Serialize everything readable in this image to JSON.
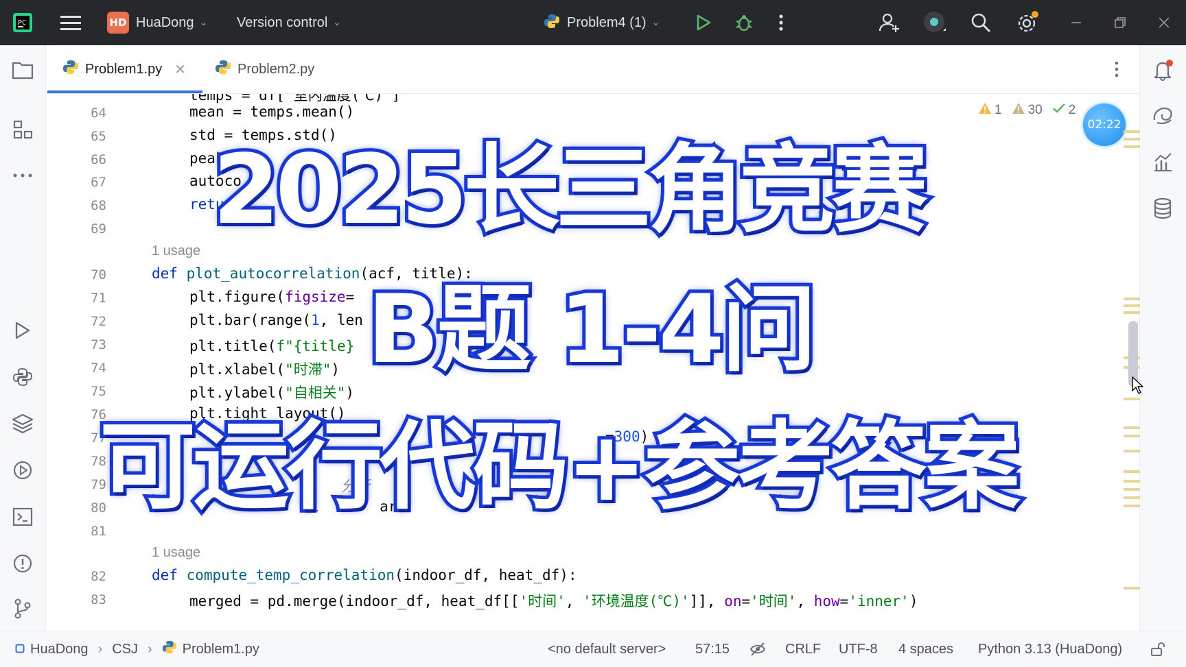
{
  "titlebar": {
    "project_badge": "HD",
    "project_name": "HuaDong",
    "vcs_label": "Version control",
    "run_config": "Problem4 (1)"
  },
  "tabs": [
    {
      "label": "Problem1.py",
      "active": true
    },
    {
      "label": "Problem2.py",
      "active": false
    }
  ],
  "inspections": {
    "warnings_a": "1",
    "warnings_b": "30",
    "ok": "2"
  },
  "timer": "02:22",
  "editor": {
    "lines": [
      {
        "n": "64",
        "code": "mean = temps.mean()"
      },
      {
        "n": "65",
        "code": "std = temps.std()"
      },
      {
        "n": "66",
        "code": "peak"
      },
      {
        "n": "67",
        "code": "autoco"
      },
      {
        "n": "68",
        "code": "retur"
      },
      {
        "n": "69",
        "code": ""
      },
      {
        "n": "70",
        "code": "def plot_autocorrelation(acf, title):"
      },
      {
        "n": "71",
        "code": "plt.figure(figsize="
      },
      {
        "n": "72",
        "code": "plt.bar(range(1, len"
      },
      {
        "n": "73",
        "code": "plt.title(f\"{title}"
      },
      {
        "n": "74",
        "code": "plt.xlabel(\"时滞\")"
      },
      {
        "n": "75",
        "code": "plt.ylabel(\"自相关\")"
      },
      {
        "n": "76",
        "code": "plt.tight_layout()"
      },
      {
        "n": "77",
        "code": "=300)"
      },
      {
        "n": "78",
        "code": ""
      },
      {
        "n": "79",
        "code": "分析"
      },
      {
        "n": "80",
        "code": "i   or  ars"
      },
      {
        "n": "81",
        "code": ""
      },
      {
        "n": "82",
        "code": "def compute_temp_correlation(indoor_df, heat_df):"
      },
      {
        "n": "83",
        "code": "merged = pd.merge(indoor_df, heat_df[['时间', '环境温度(℃)']], on='时间', how='inner')"
      }
    ],
    "usage_label_1": "1 usage",
    "usage_label_2": "1 usage"
  },
  "overlay": {
    "line1": "2025长三角竞赛",
    "line2": "B题 1-4问",
    "line3": "可运行代码+参考答案"
  },
  "statusbar": {
    "breadcrumb": [
      "HuaDong",
      "CSJ",
      "Problem1.py"
    ],
    "server": "<no default server>",
    "position": "57:15",
    "line_sep": "CRLF",
    "encoding": "UTF-8",
    "indent": "4 spaces",
    "interpreter": "Python 3.13 (HuaDong)"
  },
  "icons": [
    "pycharm-logo-icon",
    "hamburger-menu-icon",
    "python-icon",
    "run-icon",
    "debug-icon",
    "more-icon",
    "add-user-icon",
    "record-icon",
    "search-icon",
    "settings-icon",
    "minimize-icon",
    "restore-icon",
    "close-icon",
    "folder-icon",
    "structure-icon",
    "run-tool-icon",
    "python-console-icon",
    "layers-icon",
    "services-icon",
    "terminal-icon",
    "problems-icon",
    "git-icon",
    "notifications-icon",
    "ai-assistant-icon",
    "sciview-icon",
    "database-icon",
    "lock-icon",
    "inspection-icon"
  ],
  "colors": {
    "accent": "#3574f0",
    "titlebar_bg": "#27282c",
    "overlay_stroke": "#1a3ad6",
    "keyword": "#0033b3",
    "string": "#067d17"
  }
}
